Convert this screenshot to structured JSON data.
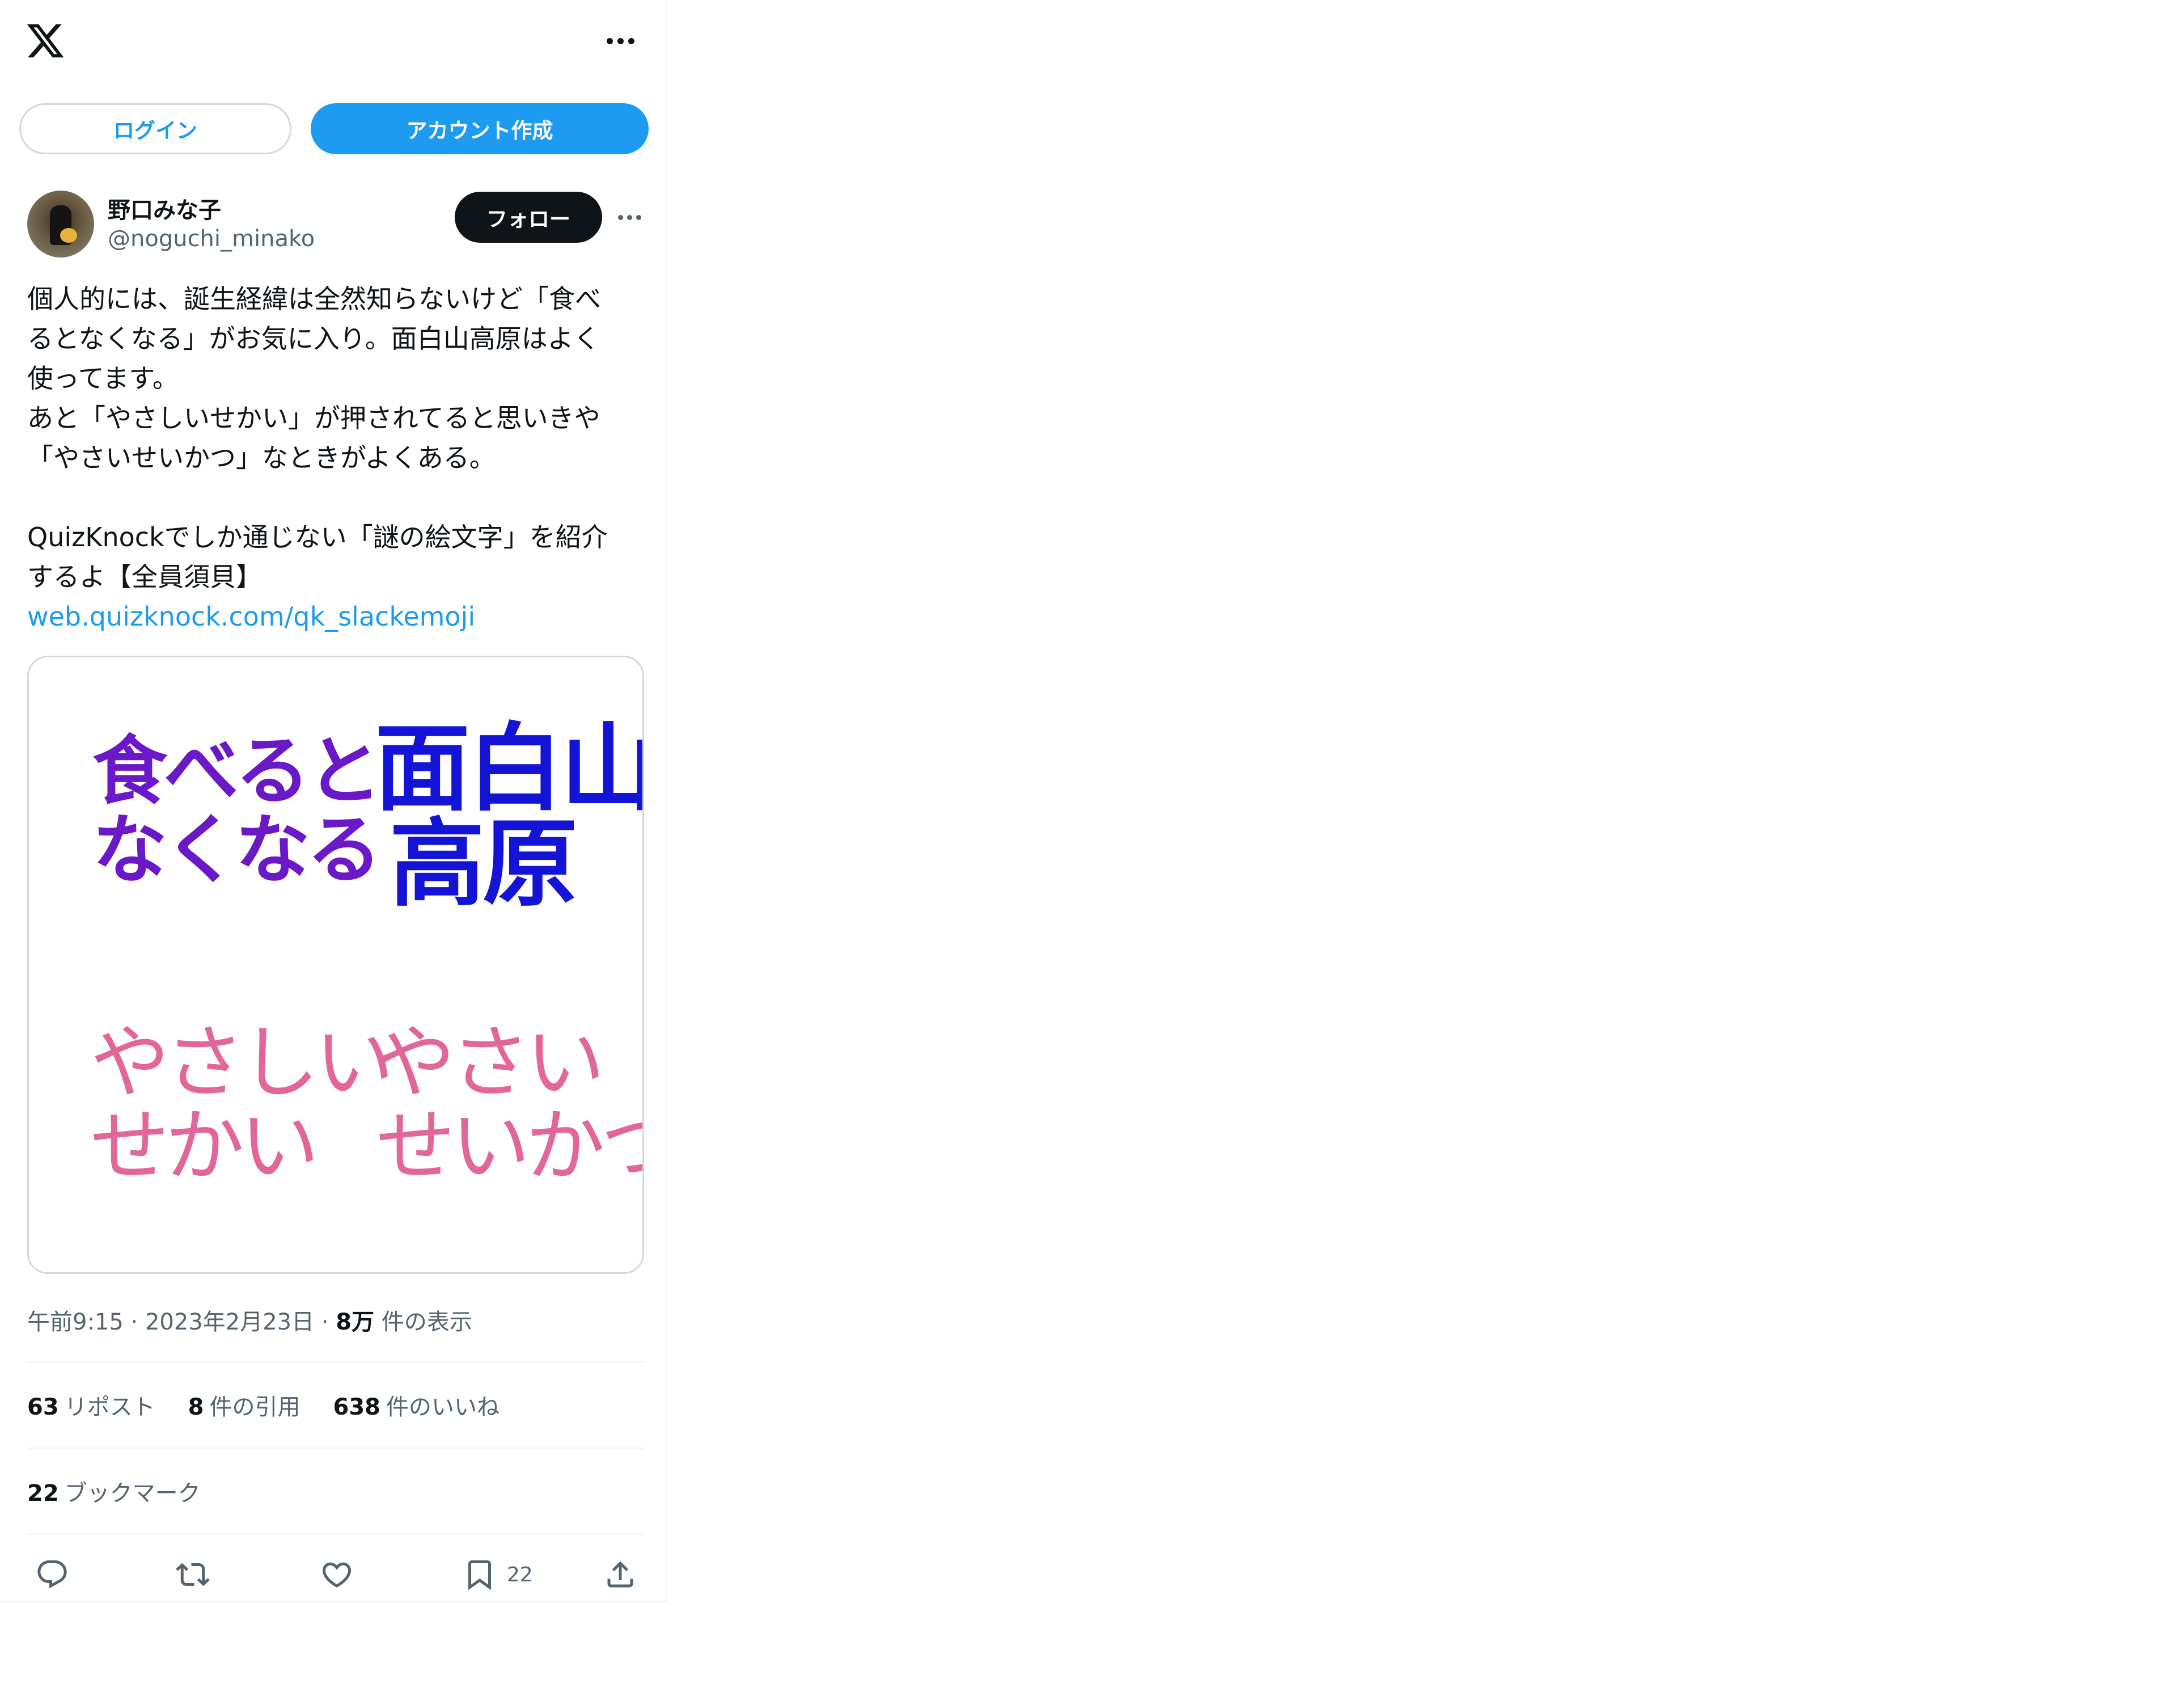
{
  "header": {
    "logo_icon": "x-logo-icon",
    "more_icon": "more-horizontal-icon"
  },
  "auth": {
    "login_label": "ログイン",
    "signup_label": "アカウント作成"
  },
  "tweet": {
    "author": {
      "display_name": "野口みな子",
      "handle": "@noguchi_minako",
      "follow_label": "フォロー"
    },
    "text_lines": [
      "個人的には、誕生経緯は全然知らないけど「食べ",
      "るとなくなる」がお気に入り。面白山高原はよく",
      "使ってます。",
      "あと「やさしいせかい」が押されてると思いきや",
      "「やさいせいかつ」なときがよくある。",
      "",
      "QuizKnockでしか通じない「謎の絵文字」を紹介",
      "するよ【全員須貝】"
    ],
    "link": "web.quizknock.com/qk_slackemoji",
    "media": {
      "emoji_1": "食べると\nなくなる",
      "emoji_2": "面白山\n高原",
      "emoji_3": "やさしい\nせかい",
      "emoji_4": "やさい\nせいかつ"
    },
    "time": "午前9:15",
    "date": "2023年2月23日",
    "views_count": "8万",
    "views_label": "件の表示",
    "stats": {
      "reposts_count": "63",
      "reposts_label": "リポスト",
      "quotes_count": "8",
      "quotes_label": "件の引用",
      "likes_count": "638",
      "likes_label": "件のいいね",
      "bookmarks_count": "22",
      "bookmarks_label": "ブックマーク"
    },
    "actions": {
      "bookmark_count": "22"
    }
  },
  "colors": {
    "accent": "#1d9bf0",
    "text_primary": "#0f1419",
    "text_secondary": "#536471",
    "border": "#cfd9de",
    "emoji_purple": "#6b18c8",
    "emoji_blue": "#1414d6",
    "emoji_pink": "#e2669a"
  }
}
